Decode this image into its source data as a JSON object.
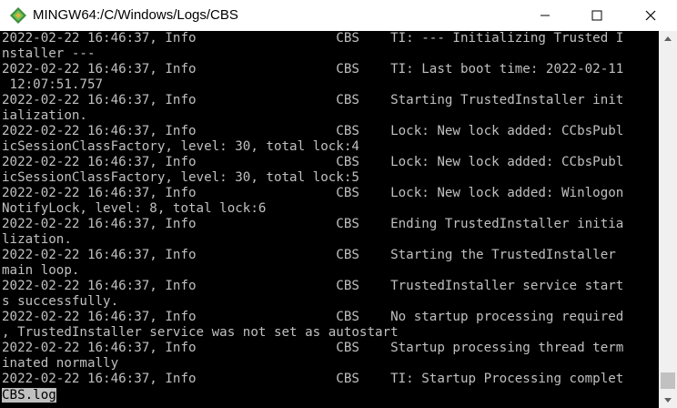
{
  "window": {
    "title": "MINGW64:/C/Windows/Logs/CBS"
  },
  "colors": {
    "terminal_bg": "#000000",
    "terminal_fg": "#c0c0c0",
    "status_bg": "#c0c0c0"
  },
  "terminal": {
    "lines": [
      "2022-02-22 16:46:37, Info                  CBS    TI: --- Initializing Trusted I",
      "nstaller ---",
      "2022-02-22 16:46:37, Info                  CBS    TI: Last boot time: 2022-02-11",
      " 12:07:51.757",
      "2022-02-22 16:46:37, Info                  CBS    Starting TrustedInstaller init",
      "ialization.",
      "2022-02-22 16:46:37, Info                  CBS    Lock: New lock added: CCbsPubl",
      "icSessionClassFactory, level: 30, total lock:4",
      "2022-02-22 16:46:37, Info                  CBS    Lock: New lock added: CCbsPubl",
      "icSessionClassFactory, level: 30, total lock:5",
      "2022-02-22 16:46:37, Info                  CBS    Lock: New lock added: Winlogon",
      "NotifyLock, level: 8, total lock:6",
      "2022-02-22 16:46:37, Info                  CBS    Ending TrustedInstaller initia",
      "lization.",
      "2022-02-22 16:46:37, Info                  CBS    Starting the TrustedInstaller",
      "main loop.",
      "2022-02-22 16:46:37, Info                  CBS    TrustedInstaller service start",
      "s successfully.",
      "2022-02-22 16:46:37, Info                  CBS    No startup processing required",
      ", TrustedInstaller service was not set as autostart",
      "2022-02-22 16:46:37, Info                  CBS    Startup processing thread term",
      "inated normally",
      "2022-02-22 16:46:37, Info                  CBS    TI: Startup Processing complet"
    ],
    "status": "CBS.log"
  },
  "icons": {
    "app": "mingw-diamond-icon",
    "minimize": "minimize-icon",
    "maximize": "maximize-icon",
    "close": "close-icon"
  }
}
